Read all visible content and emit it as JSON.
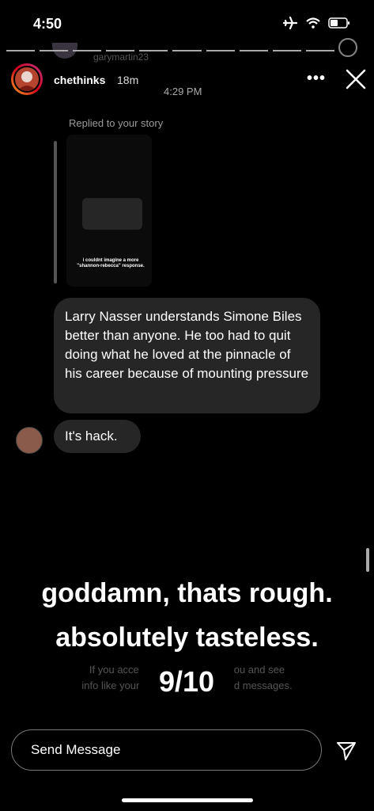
{
  "status_bar": {
    "time": "4:50"
  },
  "story_header": {
    "username": "chethinks",
    "time_ago": "18m",
    "ghost_username": "garymartin23"
  },
  "chat": {
    "timestamp": "4:29 PM",
    "replied_label": "Replied to your story",
    "story_thumbnail_text": "i couldnt imagine a more \"shannon-rebecca\" response.",
    "messages": [
      {
        "text": "Larry Nasser understands Simone Biles better than anyone. He too had to quit doing what he loved at the pinnacle of his career because of mounting pressure"
      },
      {
        "text": "It's hack."
      }
    ]
  },
  "overlay": {
    "line1": "goddamn, thats rough.",
    "line2": "absolutely tasteless.",
    "score": "9/10"
  },
  "request_notice": {
    "line1": "If you accept, membe                          e to call you and see",
    "line2": "info like your Activity S                     you've read messages."
  },
  "message_bar": {
    "placeholder": "Send Message"
  },
  "icons": {
    "airplane": "airplane-icon",
    "wifi": "wifi-icon",
    "battery": "battery-icon",
    "close": "close-icon",
    "more": "more-icon",
    "send": "send-icon"
  }
}
